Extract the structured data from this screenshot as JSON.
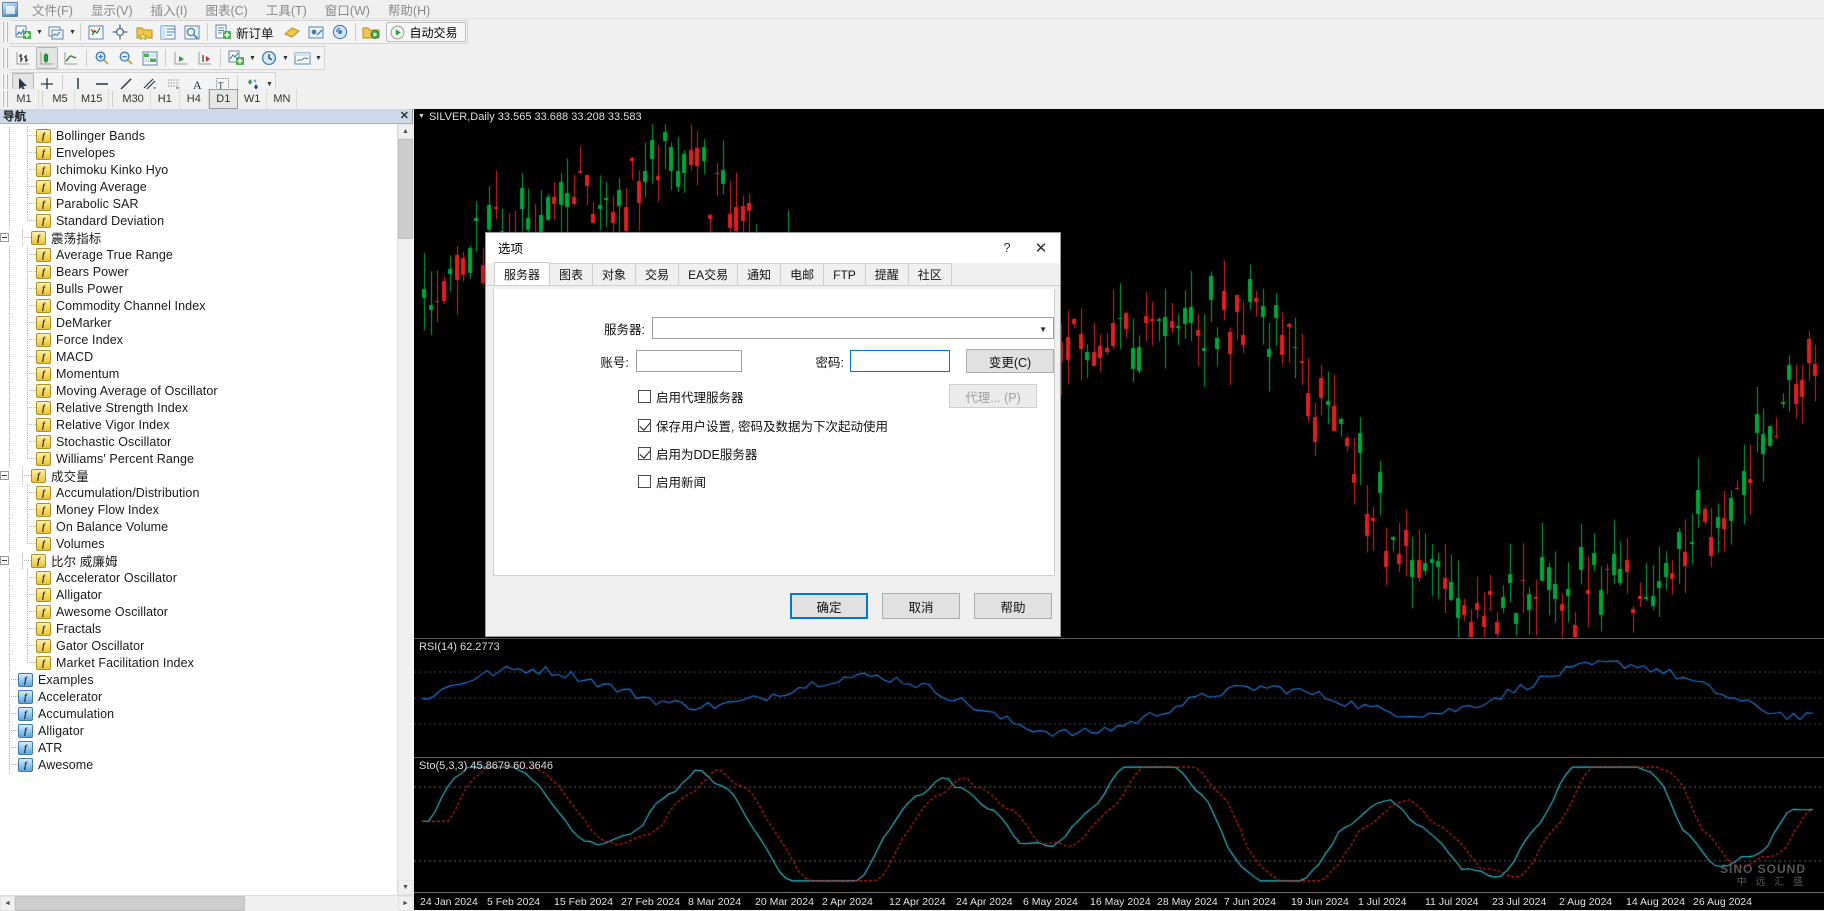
{
  "app": {
    "logo_icon": "mt4-logo-icon",
    "menu": [
      {
        "label": "文件(F)",
        "name": "menu-file"
      },
      {
        "label": "显示(V)",
        "name": "menu-view"
      },
      {
        "label": "插入(I)",
        "name": "menu-insert"
      },
      {
        "label": "图表(C)",
        "name": "menu-charts"
      },
      {
        "label": "工具(T)",
        "name": "menu-tools"
      },
      {
        "label": "窗口(W)",
        "name": "menu-window"
      },
      {
        "label": "帮助(H)",
        "name": "menu-help"
      }
    ]
  },
  "toolbar_main": {
    "new_chart_icon": "new-chart-icon",
    "profiles_icon": "profiles-icon",
    "market_watch_icon": "market-watch-icon",
    "crosshair_icon": "crosshair-icon",
    "navigator_icon": "navigator-folder-icon",
    "terminal_icon": "terminal-icon",
    "strategy_tester_icon": "strategy-tester-icon",
    "new_order_icon": "new-order-icon",
    "new_order_label": "新订单",
    "metaeditor_icon": "metaeditor-icon",
    "expert_advisor_icon": "expert-advisor-icon",
    "signals_icon": "signals-icon",
    "market_icon": "market-icon",
    "autotrade_icon": "autotrade-play-icon",
    "autotrade_label": "自动交易"
  },
  "toolbar_chart": {
    "bar_chart_icon": "bar-chart-icon",
    "candlestick_icon": "candlestick-chart-icon",
    "line_chart_icon": "line-chart-icon",
    "zoom_in_icon": "zoom-in-icon",
    "zoom_out_icon": "zoom-out-icon",
    "data_window_icon": "data-window-icon",
    "auto_scroll_icon": "auto-scroll-icon",
    "chart_shift_icon": "chart-shift-icon",
    "indicators_icon": "indicators-icon",
    "periods_icon": "periods-clock-icon",
    "templates_icon": "templates-icon"
  },
  "toolbar_draw": {
    "cursor_icon": "cursor-arrow-icon",
    "crosshair_icon": "crosshair-icon",
    "vline_icon": "vertical-line-icon",
    "hline_icon": "horizontal-line-icon",
    "trendline_icon": "trendline-icon",
    "equidistant_icon": "equidistant-channel-icon",
    "fibonacci_icon": "fibonacci-retracement-icon",
    "text_icon": "text-icon",
    "text_label_icon": "text-label-icon",
    "shapes_icon": "shapes-arrows-icon"
  },
  "periods": {
    "items": [
      "M1",
      "M5",
      "M15",
      "M30",
      "H1",
      "H4",
      "D1",
      "W1",
      "MN"
    ],
    "active": "D1"
  },
  "navigator": {
    "title": "导航",
    "close_icon": "close-icon",
    "tree": [
      {
        "label": "Bollinger Bands",
        "depth": 3,
        "icon": "f",
        "type": "leaf",
        "guide": "tee"
      },
      {
        "label": "Envelopes",
        "depth": 3,
        "icon": "f",
        "type": "leaf",
        "guide": "tee"
      },
      {
        "label": "Ichimoku Kinko Hyo",
        "depth": 3,
        "icon": "f",
        "type": "leaf",
        "guide": "tee"
      },
      {
        "label": "Moving Average",
        "depth": 3,
        "icon": "f",
        "type": "leaf",
        "guide": "tee"
      },
      {
        "label": "Parabolic SAR",
        "depth": 3,
        "icon": "f",
        "type": "leaf",
        "guide": "tee"
      },
      {
        "label": "Standard Deviation",
        "depth": 3,
        "icon": "f",
        "type": "leaf",
        "guide": "ell"
      },
      {
        "label": "震荡指标",
        "depth": 2,
        "icon": "f",
        "type": "group",
        "guide": "tee"
      },
      {
        "label": "Average True Range",
        "depth": 3,
        "icon": "f",
        "type": "leaf",
        "guide": "tee"
      },
      {
        "label": "Bears Power",
        "depth": 3,
        "icon": "f",
        "type": "leaf",
        "guide": "tee"
      },
      {
        "label": "Bulls Power",
        "depth": 3,
        "icon": "f",
        "type": "leaf",
        "guide": "tee"
      },
      {
        "label": "Commodity Channel Index",
        "depth": 3,
        "icon": "f",
        "type": "leaf",
        "guide": "tee"
      },
      {
        "label": "DeMarker",
        "depth": 3,
        "icon": "f",
        "type": "leaf",
        "guide": "tee"
      },
      {
        "label": "Force Index",
        "depth": 3,
        "icon": "f",
        "type": "leaf",
        "guide": "tee"
      },
      {
        "label": "MACD",
        "depth": 3,
        "icon": "f",
        "type": "leaf",
        "guide": "tee"
      },
      {
        "label": "Momentum",
        "depth": 3,
        "icon": "f",
        "type": "leaf",
        "guide": "tee"
      },
      {
        "label": "Moving Average of Oscillator",
        "depth": 3,
        "icon": "f",
        "type": "leaf",
        "guide": "tee"
      },
      {
        "label": "Relative Strength Index",
        "depth": 3,
        "icon": "f",
        "type": "leaf",
        "guide": "tee"
      },
      {
        "label": "Relative Vigor Index",
        "depth": 3,
        "icon": "f",
        "type": "leaf",
        "guide": "tee"
      },
      {
        "label": "Stochastic Oscillator",
        "depth": 3,
        "icon": "f",
        "type": "leaf",
        "guide": "tee"
      },
      {
        "label": "Williams' Percent Range",
        "depth": 3,
        "icon": "f",
        "type": "leaf",
        "guide": "ell"
      },
      {
        "label": "成交量",
        "depth": 2,
        "icon": "f",
        "type": "group",
        "guide": "tee"
      },
      {
        "label": "Accumulation/Distribution",
        "depth": 3,
        "icon": "f",
        "type": "leaf",
        "guide": "tee"
      },
      {
        "label": "Money Flow Index",
        "depth": 3,
        "icon": "f",
        "type": "leaf",
        "guide": "tee"
      },
      {
        "label": "On Balance Volume",
        "depth": 3,
        "icon": "f",
        "type": "leaf",
        "guide": "tee"
      },
      {
        "label": "Volumes",
        "depth": 3,
        "icon": "f",
        "type": "leaf",
        "guide": "ell"
      },
      {
        "label": "比尔 威廉姆",
        "depth": 2,
        "icon": "f",
        "type": "group",
        "guide": "tee"
      },
      {
        "label": "Accelerator Oscillator",
        "depth": 3,
        "icon": "f",
        "type": "leaf",
        "guide": "tee"
      },
      {
        "label": "Alligator",
        "depth": 3,
        "icon": "f",
        "type": "leaf",
        "guide": "tee"
      },
      {
        "label": "Awesome Oscillator",
        "depth": 3,
        "icon": "f",
        "type": "leaf",
        "guide": "tee"
      },
      {
        "label": "Fractals",
        "depth": 3,
        "icon": "f",
        "type": "leaf",
        "guide": "tee"
      },
      {
        "label": "Gator Oscillator",
        "depth": 3,
        "icon": "f",
        "type": "leaf",
        "guide": "tee"
      },
      {
        "label": "Market Facilitation Index",
        "depth": 3,
        "icon": "f",
        "type": "leaf",
        "guide": "ell"
      },
      {
        "label": "Examples",
        "depth": 2,
        "icon": "f-blue",
        "type": "leaf",
        "guide": "tee"
      },
      {
        "label": "Accelerator",
        "depth": 2,
        "icon": "f-blue",
        "type": "leaf",
        "guide": "tee"
      },
      {
        "label": "Accumulation",
        "depth": 2,
        "icon": "f-blue",
        "type": "leaf",
        "guide": "tee"
      },
      {
        "label": "Alligator",
        "depth": 2,
        "icon": "f-blue",
        "type": "leaf",
        "guide": "tee"
      },
      {
        "label": "ATR",
        "depth": 2,
        "icon": "f-blue",
        "type": "leaf",
        "guide": "tee"
      },
      {
        "label": "Awesome",
        "depth": 2,
        "icon": "f-blue",
        "type": "leaf",
        "guide": "tee"
      }
    ]
  },
  "chart": {
    "title": "SILVER,Daily  33.565 33.688 33.208 33.583",
    "collapse_icon": "chevron-down-icon",
    "rsi_label": "RSI(14) 62.2773",
    "sto_label": "Sto(5,3,3) 45.8679 60.3646",
    "watermark_line1": "SINO SOUND",
    "watermark_line2": "中 远 汇 盛",
    "x_ticks": [
      "24 Jan 2024",
      "5 Feb 2024",
      "15 Feb 2024",
      "27 Feb 2024",
      "8 Mar 2024",
      "20 Mar 2024",
      "2 Apr 2024",
      "12 Apr 2024",
      "24 Apr 2024",
      "6 May 2024",
      "16 May 2024",
      "28 May 2024",
      "7 Jun 2024",
      "19 Jun 2024",
      "1 Jul 2024",
      "11 Jul 2024",
      "23 Jul 2024",
      "2 Aug 2024",
      "14 Aug 2024",
      "26 Aug 2024"
    ],
    "colors": {
      "bull": "#00a63c",
      "bear": "#e02020",
      "background": "#000000",
      "rsi_line": "#1e7ce0",
      "sto_main": "#2ec6d6",
      "sto_signal": "#e02020"
    }
  },
  "dialog": {
    "title": "选项",
    "help_icon": "question-mark-icon",
    "close_icon": "close-icon",
    "tabs": [
      {
        "label": "服务器",
        "active": true
      },
      {
        "label": "图表",
        "active": false
      },
      {
        "label": "对象",
        "active": false
      },
      {
        "label": "交易",
        "active": false
      },
      {
        "label": "EA交易",
        "active": false
      },
      {
        "label": "通知",
        "active": false
      },
      {
        "label": "电邮",
        "active": false
      },
      {
        "label": "FTP",
        "active": false
      },
      {
        "label": "提醒",
        "active": false
      },
      {
        "label": "社区",
        "active": false
      }
    ],
    "server_label": "服务器:",
    "server_value": "",
    "server_dropdown_icon": "chevron-down-icon",
    "account_label": "账号:",
    "account_value": "",
    "password_label": "密码:",
    "password_value": "",
    "change_button": "变更(C)",
    "proxy_button": "代理... (P)",
    "checkboxes": [
      {
        "label": "启用代理服务器",
        "checked": false,
        "name": "enable-proxy-server-checkbox"
      },
      {
        "label": "保存用户设置, 密码及数据为下次起动使用",
        "checked": true,
        "name": "save-account-info-checkbox"
      },
      {
        "label": "启用为DDE服务器",
        "checked": true,
        "name": "enable-dde-server-checkbox"
      },
      {
        "label": "启用新闻",
        "checked": false,
        "name": "enable-news-checkbox"
      }
    ],
    "ok_button": "确定",
    "cancel_button": "取消",
    "help_button": "帮助"
  }
}
